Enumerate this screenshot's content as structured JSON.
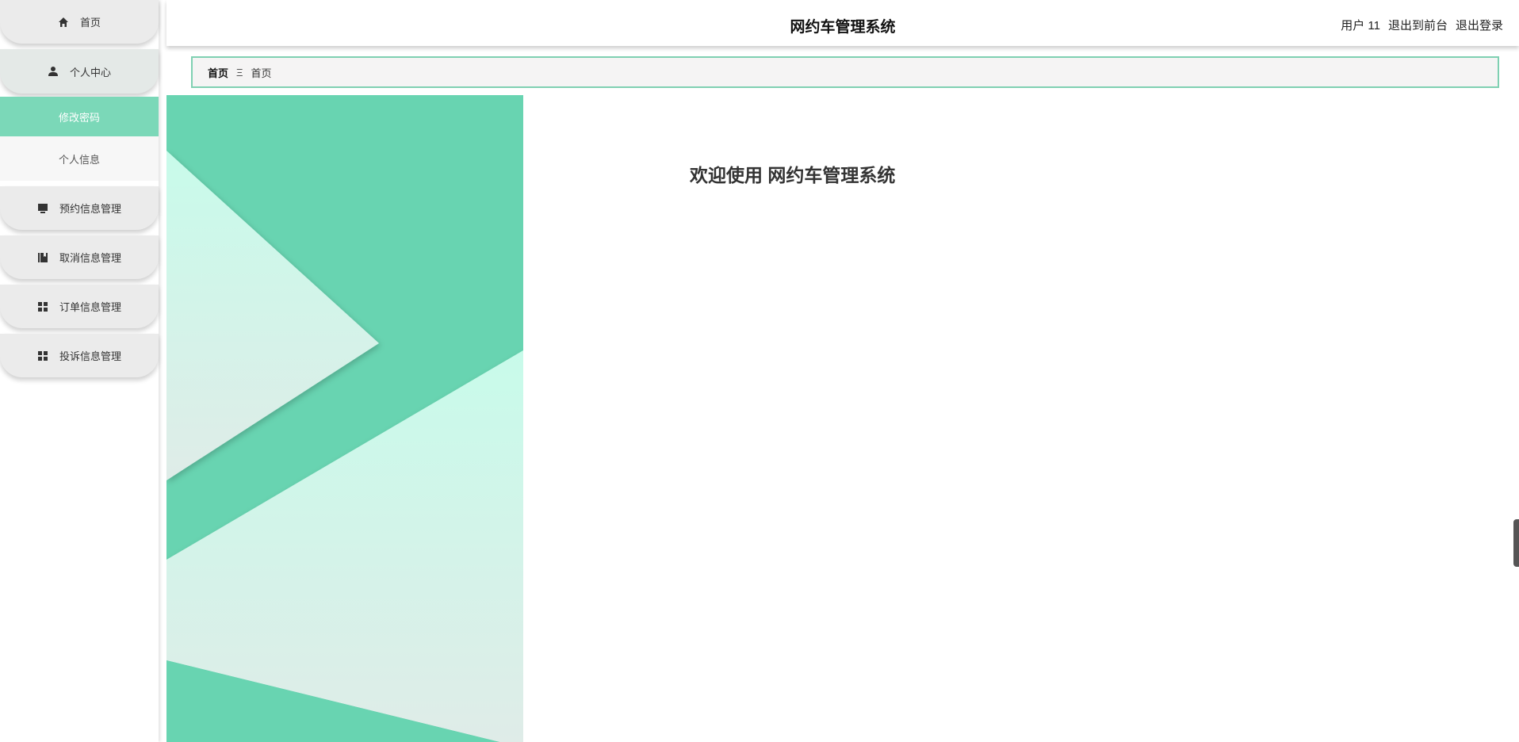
{
  "header": {
    "title": "网约车管理系统",
    "user_label": "用户 11",
    "back_to_front": "退出到前台",
    "logout": "退出登录"
  },
  "breadcrumb": {
    "root": "首页",
    "separator": "Ξ",
    "current": "首页"
  },
  "sidebar": {
    "items": [
      {
        "label": "首页",
        "icon": "home-icon"
      },
      {
        "label": "个人中心",
        "icon": "user-icon"
      },
      {
        "label": "预约信息管理",
        "icon": "monitor-icon"
      },
      {
        "label": "取消信息管理",
        "icon": "book-icon"
      },
      {
        "label": "订单信息管理",
        "icon": "grid-icon"
      },
      {
        "label": "投诉信息管理",
        "icon": "grid-icon"
      }
    ],
    "submenu": [
      {
        "label": "修改密码",
        "active": true
      },
      {
        "label": "个人信息",
        "active": false
      }
    ]
  },
  "main": {
    "welcome": "欢迎使用 网约车管理系统"
  },
  "colors": {
    "accent": "#6ad4b0",
    "active_bg": "#7bd8b8",
    "breadcrumb_border": "#7fd0b2"
  }
}
